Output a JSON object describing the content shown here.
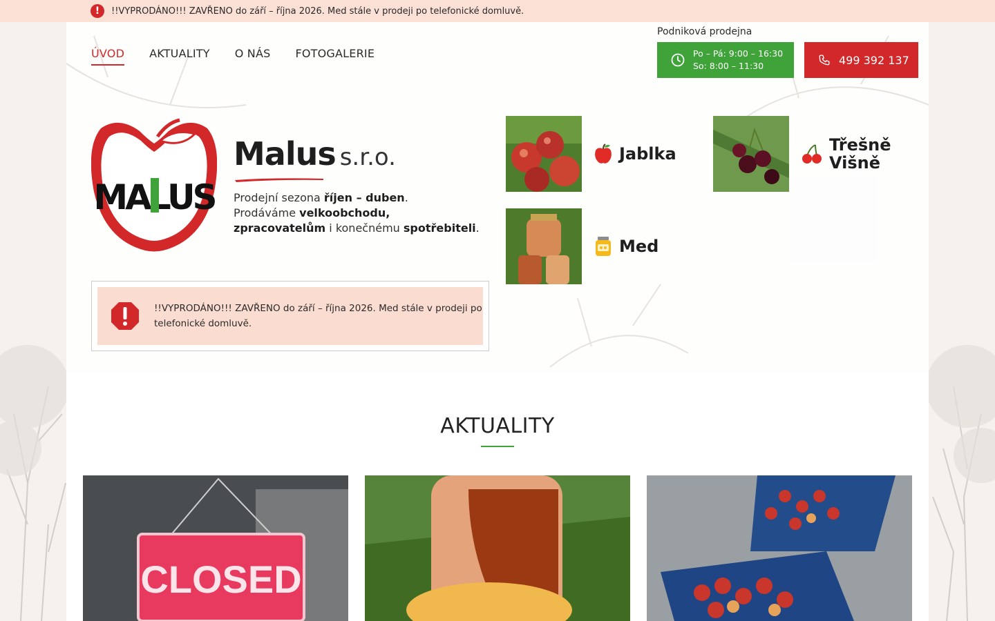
{
  "notice": {
    "text": "!!VYPRODÁNO!!! ZAVŘENO do září – října 2026. Med stále v prodeji po telefonické domluvě.",
    "icon": "exclamation-circle-icon"
  },
  "nav": {
    "items": [
      {
        "label": "ÚVOD",
        "active": true
      },
      {
        "label": "AKTUALITY",
        "active": false
      },
      {
        "label": "O NÁS",
        "active": false
      },
      {
        "label": "FOTOGALERIE",
        "active": false
      }
    ]
  },
  "shop": {
    "label": "Podniková prodejna",
    "hours_line1": "Po – Pá: 9:00 – 16:30",
    "hours_line2": "So: 8:00 – 11:30",
    "phone": "499 392 137"
  },
  "brand": {
    "logo_text": "MALUS",
    "name": "Malus",
    "suffix": "s.r.o.",
    "desc_1a": "Prodejní sezona ",
    "desc_1b": "říjen – duben",
    "desc_1c": ".",
    "desc_2a": "Prodáváme ",
    "desc_2b": "velkoobchodu, zpracovatelům",
    "desc_2c": " i konečnému ",
    "desc_2d": "spotřebiteli",
    "desc_2e": "."
  },
  "alert": {
    "text": "!!VYPRODÁNO!!! ZAVŘENO do září – října 2026. Med stále v prodeji po telefonické domluvě."
  },
  "products": [
    {
      "label": "Jablka",
      "icon": "apple-icon"
    },
    {
      "label_1": "Třešně",
      "label_2": "Višně",
      "icon": "cherry-icon"
    },
    {
      "label": "Med",
      "icon": "honey-jar-icon"
    }
  ],
  "news": {
    "title": "AKTUALITY",
    "cards": [
      {
        "image": "closed-sign",
        "sign_text": "CLOSED"
      },
      {
        "image": "honey-jar"
      },
      {
        "image": "apple-crates"
      }
    ]
  },
  "colors": {
    "accent_red": "#d3282a",
    "accent_green": "#3fa33a",
    "notice_bg": "#fbe0d6"
  }
}
